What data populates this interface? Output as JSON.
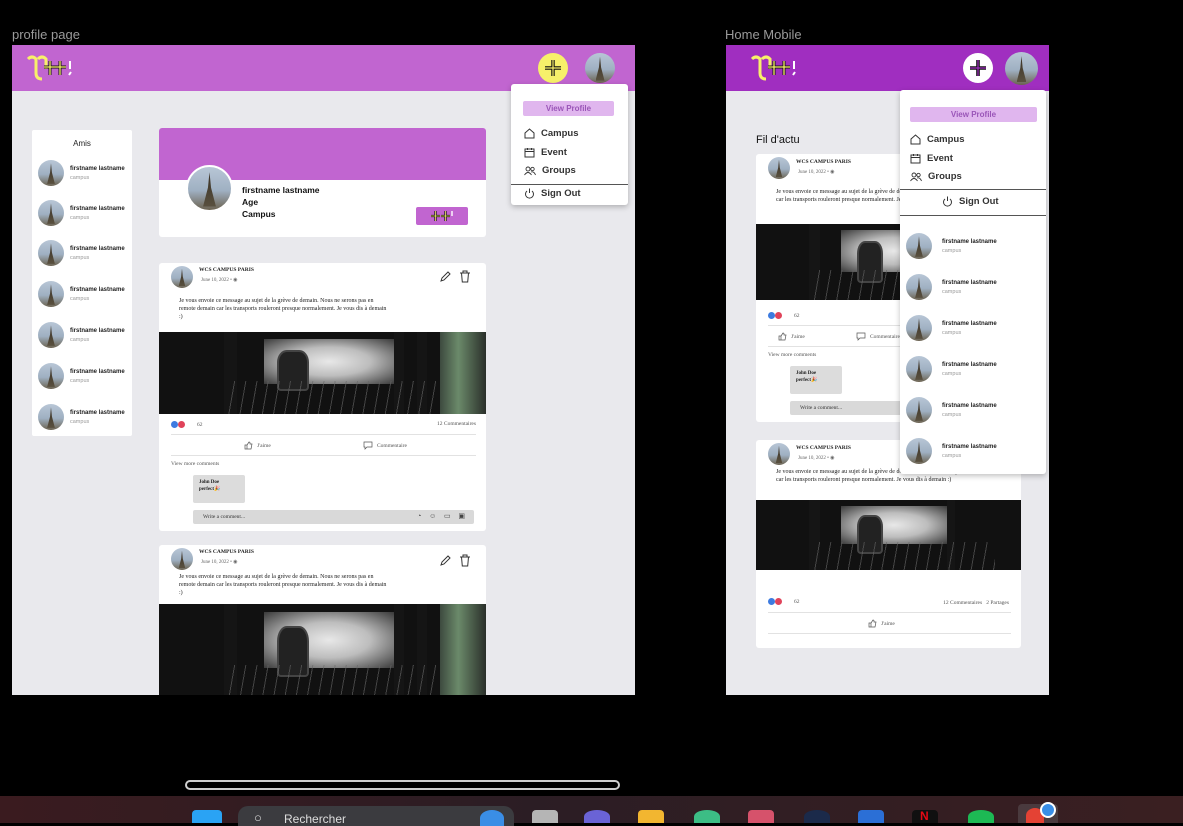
{
  "frames": {
    "profile_label": "profile page",
    "mobile_label": "Home Mobile"
  },
  "colors": {
    "brand_purple": "#c165d0",
    "brand_purple_dark": "#a02ec0",
    "plus_yellow": "#f7f06a"
  },
  "menu": {
    "view_profile": "View Profile",
    "items": [
      {
        "label": "Campus",
        "icon": "home-icon"
      },
      {
        "label": "Event",
        "icon": "calendar-icon"
      },
      {
        "label": "Groups",
        "icon": "users-icon"
      }
    ],
    "sign_out": "Sign Out"
  },
  "friends": {
    "title": "Amis",
    "list": [
      {
        "name": "firstname lastname",
        "sub": "campus"
      },
      {
        "name": "firstname lastname",
        "sub": "campus"
      },
      {
        "name": "firstname lastname",
        "sub": "campus"
      },
      {
        "name": "firstname lastname",
        "sub": "campus"
      },
      {
        "name": "firstname lastname",
        "sub": "campus"
      },
      {
        "name": "firstname lastname",
        "sub": "campus"
      },
      {
        "name": "firstname lastname",
        "sub": "campus"
      }
    ]
  },
  "profile": {
    "name": "firstname lastname",
    "age": "Age",
    "campus": "Campus"
  },
  "posts": [
    {
      "author": "WCS CAMPUS PARIS",
      "date": "June 10, 2022 • ",
      "text": "Je vous envoie ce message au sujet de la grève de demain. Nous ne serons pas en remote demain car les transports rouleront presque normalement. Je vous dis à demain :)",
      "reactions": "62",
      "comments_count": "12 Commentaires",
      "like": "J'aime",
      "comment": "Commentaire",
      "view_more": "View more comments",
      "comment_author": "John Doe",
      "comment_text": "perfect🎉",
      "write_placeholder": "Write a comment..."
    },
    {
      "author": "WCS CAMPUS PARIS",
      "date": "June 10, 2022 • ",
      "text": "Je vous envoie ce message au sujet de la grève de demain. Nous ne serons pas en remote demain car les transports rouleront presque normalement. Je vous dis à demain :)"
    }
  ],
  "mobile": {
    "feed_title": "Fil d'actu",
    "post1": {
      "author": "WCS CAMPUS PARIS",
      "date": "June 10, 2022 • ",
      "text": "Je vous envoie ce message au sujet de la grève de demain. Nous ne serons pas en remote demain car les transports rouleront presque normalement. Je vous dis à demain :)",
      "reactions": "62",
      "like": "J'aime",
      "comment": "Commentaire",
      "view_more": "View more comments",
      "comment_author": "John Doe",
      "comment_text": "perfect🎉",
      "write_placeholder": "Write a comment..."
    },
    "post2": {
      "author": "WCS CAMPUS PARIS",
      "date": "June 10, 2022 • ",
      "text": "Je vous envoie ce message au sujet de la grève de demain. Nous ne serons pas en remote demain car les transports rouleront presque normalement. Je vous dis à demain :)",
      "reactions": "62",
      "comments_count": "12 Commentaires",
      "shares": "2 Partages",
      "like": "J'aime"
    },
    "friends": [
      {
        "name": "firstname lastname",
        "sub": "campus"
      },
      {
        "name": "firstname lastname",
        "sub": "campus"
      },
      {
        "name": "firstname lastname",
        "sub": "campus"
      },
      {
        "name": "firstname lastname",
        "sub": "campus"
      },
      {
        "name": "firstname lastname",
        "sub": "campus"
      },
      {
        "name": "firstname lastname",
        "sub": "campus"
      }
    ]
  },
  "taskbar": {
    "search_text": "Rechercher"
  }
}
